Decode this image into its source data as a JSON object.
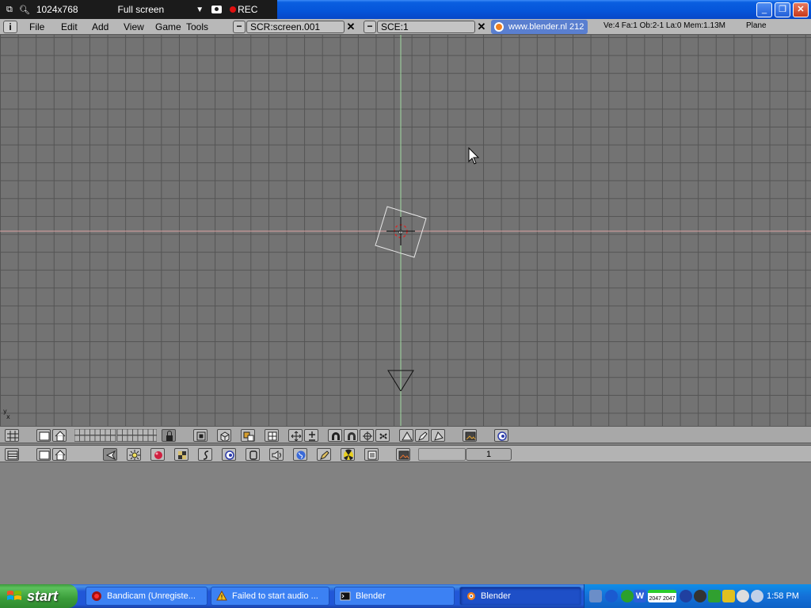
{
  "recorder": {
    "resolution": "1024x768",
    "mode": "Full screen",
    "rec_label": "REC"
  },
  "window_controls": {
    "minimize": "_",
    "maximize": "❐",
    "close": "✕"
  },
  "info_header": {
    "menus": [
      "File",
      "Edit",
      "Add",
      "View",
      "Game",
      "Tools"
    ],
    "screen_field": "SCR:screen.001",
    "scene_field": "SCE:1",
    "url": "www.blender.nl 212",
    "stats": "Ve:4 Fa:1  Ob:2-1 La:0  Mem:1.13M",
    "active_object": "Plane"
  },
  "viewport": {
    "axis_y": "y",
    "axis_x": "x"
  },
  "buttons_header": {
    "frame": "1"
  },
  "taskbar": {
    "start_label": "start",
    "tasks": [
      {
        "label": "Bandicam (Unregiste...",
        "icon": "bandicam-icon"
      },
      {
        "label": "Failed to start audio ...",
        "icon": "warning-icon"
      },
      {
        "label": "Blender",
        "icon": "console-icon"
      },
      {
        "label": "Blender",
        "icon": "blender-icon"
      }
    ],
    "clock": "1:58 PM",
    "tray_text": "2047 2047"
  },
  "colors": {
    "viewport_bg": "#737373",
    "grid_line": "#545454",
    "x_axis": "#d8a0a0",
    "y_axis": "#a0d8a0",
    "xp_blue": "#0554d9",
    "start_green": "#3a9d3a"
  }
}
